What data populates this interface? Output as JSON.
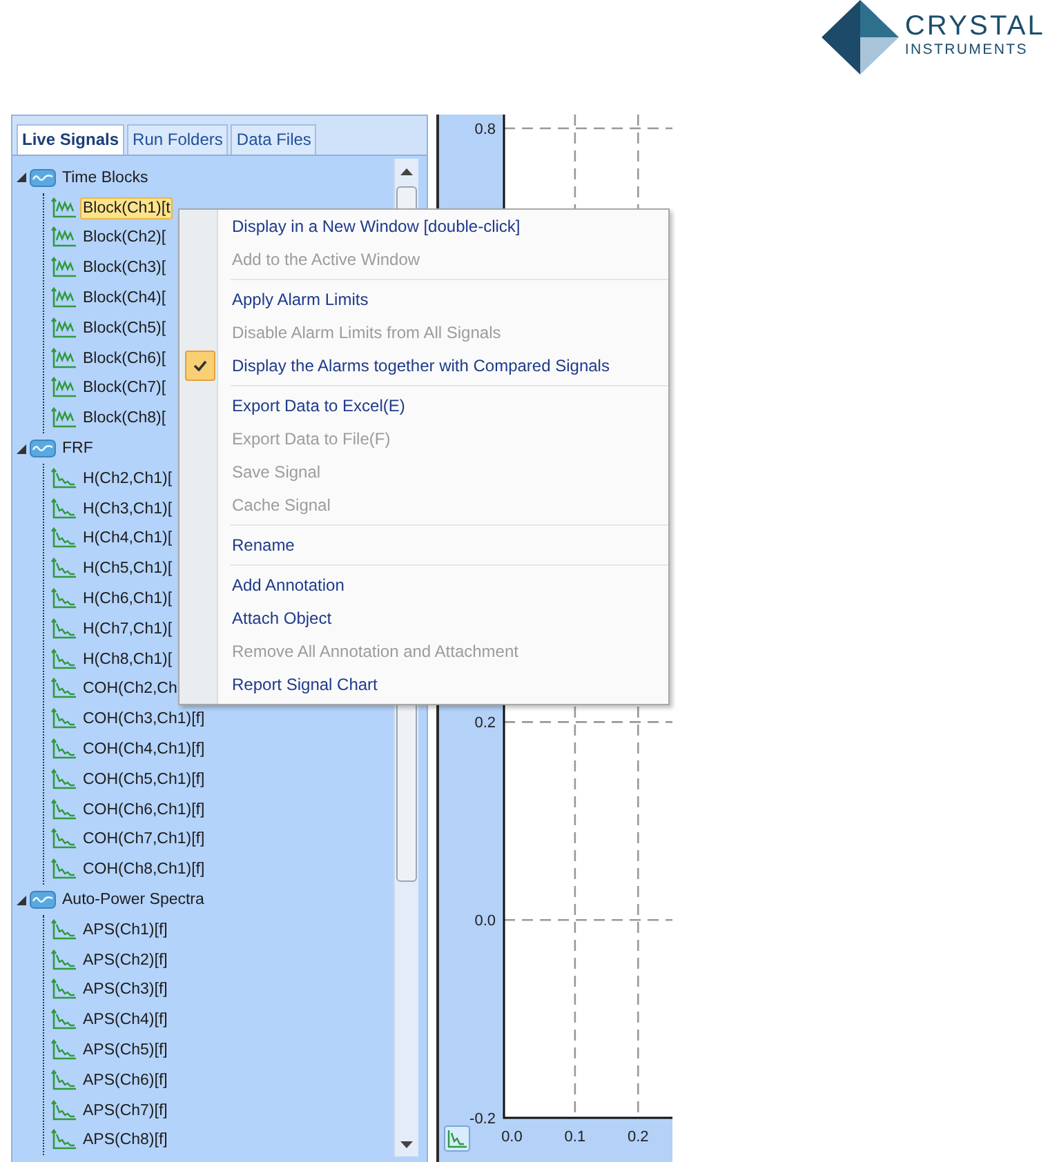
{
  "logo": {
    "name": "CRYSTAL",
    "tagline": "INSTRUMENTS"
  },
  "tabs": [
    {
      "label": "Live Signals",
      "selected": true
    },
    {
      "label": "Run Folders",
      "selected": false
    },
    {
      "label": "Data Files",
      "selected": false
    }
  ],
  "tree": [
    {
      "label": "Time Blocks",
      "expanded": true,
      "selected": false,
      "children": [
        {
          "label": "Block(Ch1)[t",
          "kind": "time",
          "selected": true
        },
        {
          "label": "Block(Ch2)[",
          "kind": "time",
          "selected": false
        },
        {
          "label": "Block(Ch3)[",
          "kind": "time",
          "selected": false
        },
        {
          "label": "Block(Ch4)[",
          "kind": "time",
          "selected": false
        },
        {
          "label": "Block(Ch5)[",
          "kind": "time",
          "selected": false
        },
        {
          "label": "Block(Ch6)[",
          "kind": "time",
          "selected": false
        },
        {
          "label": "Block(Ch7)[",
          "kind": "time",
          "selected": false
        },
        {
          "label": "Block(Ch8)[",
          "kind": "time",
          "selected": false
        }
      ]
    },
    {
      "label": "FRF",
      "expanded": true,
      "selected": false,
      "children": [
        {
          "label": "H(Ch2,Ch1)[",
          "kind": "spectrum",
          "selected": false
        },
        {
          "label": "H(Ch3,Ch1)[",
          "kind": "spectrum",
          "selected": false
        },
        {
          "label": "H(Ch4,Ch1)[",
          "kind": "spectrum",
          "selected": false
        },
        {
          "label": "H(Ch5,Ch1)[",
          "kind": "spectrum",
          "selected": false
        },
        {
          "label": "H(Ch6,Ch1)[",
          "kind": "spectrum",
          "selected": false
        },
        {
          "label": "H(Ch7,Ch1)[",
          "kind": "spectrum",
          "selected": false
        },
        {
          "label": "H(Ch8,Ch1)[",
          "kind": "spectrum",
          "selected": false
        },
        {
          "label": "COH(Ch2,Ch",
          "kind": "spectrum",
          "selected": false
        },
        {
          "label": "COH(Ch3,Ch1)[f]",
          "kind": "spectrum",
          "selected": false
        },
        {
          "label": "COH(Ch4,Ch1)[f]",
          "kind": "spectrum",
          "selected": false
        },
        {
          "label": "COH(Ch5,Ch1)[f]",
          "kind": "spectrum",
          "selected": false
        },
        {
          "label": "COH(Ch6,Ch1)[f]",
          "kind": "spectrum",
          "selected": false
        },
        {
          "label": "COH(Ch7,Ch1)[f]",
          "kind": "spectrum",
          "selected": false
        },
        {
          "label": "COH(Ch8,Ch1)[f]",
          "kind": "spectrum",
          "selected": false
        }
      ]
    },
    {
      "label": "Auto-Power Spectra",
      "expanded": true,
      "selected": false,
      "children": [
        {
          "label": "APS(Ch1)[f]",
          "kind": "spectrum",
          "selected": false
        },
        {
          "label": "APS(Ch2)[f]",
          "kind": "spectrum",
          "selected": false
        },
        {
          "label": "APS(Ch3)[f]",
          "kind": "spectrum",
          "selected": false
        },
        {
          "label": "APS(Ch4)[f]",
          "kind": "spectrum",
          "selected": false
        },
        {
          "label": "APS(Ch5)[f]",
          "kind": "spectrum",
          "selected": false
        },
        {
          "label": "APS(Ch6)[f]",
          "kind": "spectrum",
          "selected": false
        },
        {
          "label": "APS(Ch7)[f]",
          "kind": "spectrum",
          "selected": false
        },
        {
          "label": "APS(Ch8)[f]",
          "kind": "spectrum",
          "selected": false
        }
      ]
    }
  ],
  "chart": {
    "chart_data": {
      "type": "line",
      "grid": true,
      "xlim": [
        -0.0125,
        0.25
      ],
      "ylim": [
        -0.2,
        0.8
      ],
      "xticks": [
        {
          "value": 0,
          "label": "0.0"
        },
        {
          "value": 0.1,
          "label": "0.1"
        },
        {
          "value": 0.2,
          "label": "0.2"
        }
      ],
      "yticks": [
        {
          "value": 0.8,
          "label": "0.8"
        },
        {
          "value": 0.2,
          "label": "0.2"
        },
        {
          "value": 0,
          "label": "0.0"
        },
        {
          "value": -0.2,
          "label": "-0.2"
        }
      ]
    }
  },
  "context_menu": {
    "items": [
      {
        "kind": "item",
        "label": "Display in a New Window [double-click]",
        "disabled": false,
        "checked": false
      },
      {
        "kind": "item",
        "label": "Add to the Active Window",
        "disabled": true,
        "checked": false
      },
      {
        "kind": "separator"
      },
      {
        "kind": "item",
        "label": "Apply Alarm Limits",
        "disabled": false,
        "checked": false
      },
      {
        "kind": "item",
        "label": "Disable Alarm Limits from All Signals",
        "disabled": true,
        "checked": false
      },
      {
        "kind": "item",
        "label": "Display the Alarms together with Compared Signals",
        "disabled": false,
        "checked": true
      },
      {
        "kind": "separator"
      },
      {
        "kind": "item",
        "label": "Export Data to Excel(E)",
        "disabled": false,
        "checked": false
      },
      {
        "kind": "item",
        "label": "Export Data to File(F)",
        "disabled": true,
        "checked": false
      },
      {
        "kind": "item",
        "label": "Save Signal",
        "disabled": true,
        "checked": false
      },
      {
        "kind": "item",
        "label": "Cache Signal",
        "disabled": true,
        "checked": false
      },
      {
        "kind": "separator"
      },
      {
        "kind": "item",
        "label": "Rename",
        "disabled": false,
        "checked": false
      },
      {
        "kind": "separator"
      },
      {
        "kind": "item",
        "label": "Add Annotation",
        "disabled": false,
        "checked": false
      },
      {
        "kind": "item",
        "label": "Attach Object",
        "disabled": false,
        "checked": false
      },
      {
        "kind": "item",
        "label": "Remove All Annotation and Attachment",
        "disabled": true,
        "checked": false
      },
      {
        "kind": "item",
        "label": "Report Signal Chart",
        "disabled": false,
        "checked": false
      }
    ]
  }
}
